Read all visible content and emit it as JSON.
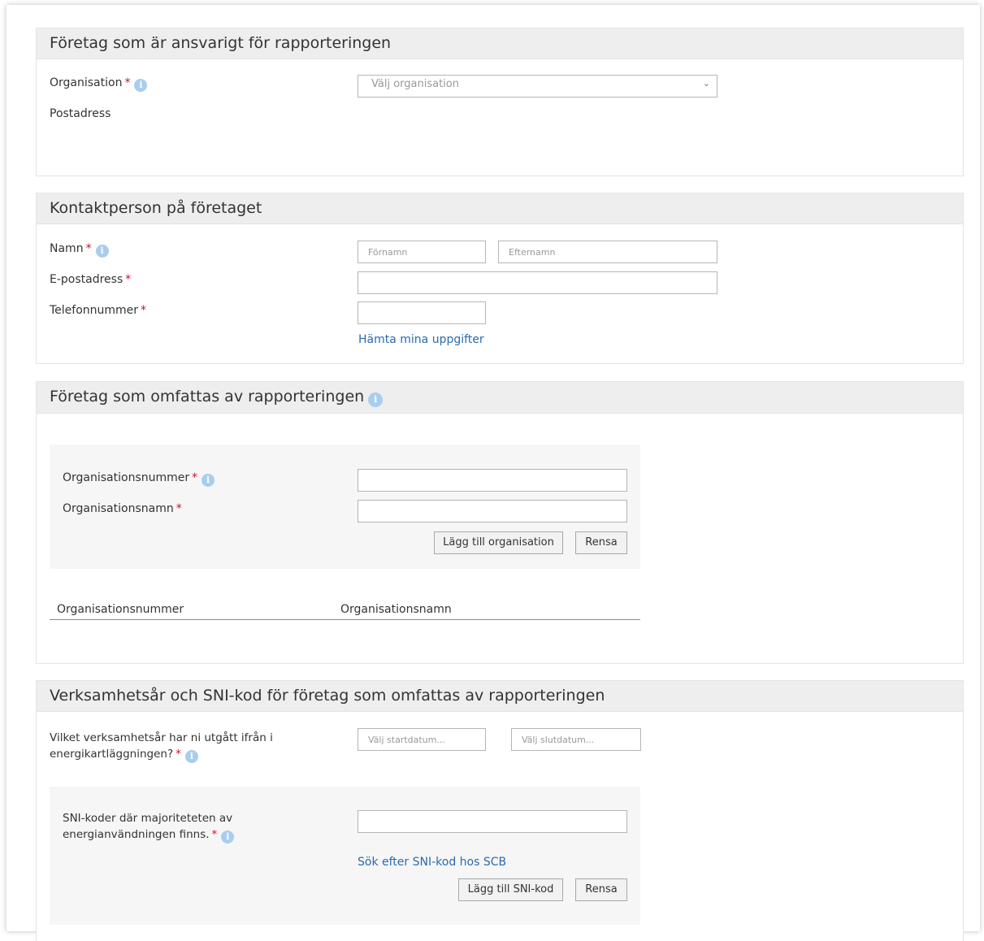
{
  "sections": {
    "responsible": {
      "title": "Företag som är ansvarigt för rapporteringen",
      "organisation_label": "Organisation",
      "organisation_placeholder": "Välj organisation",
      "postaddress_label": "Postadress"
    },
    "contact": {
      "title": "Kontaktperson på företaget",
      "name_label": "Namn",
      "firstname_placeholder": "Förnamn",
      "lastname_placeholder": "Efternamn",
      "email_label": "E-postadress",
      "phone_label": "Telefonnummer",
      "fetch_link": "Hämta mina uppgifter"
    },
    "included": {
      "title": "Företag som omfattas av rapporteringen",
      "orgnumber_label": "Organisationsnummer",
      "orgname_label": "Organisationsnamn",
      "add_button": "Lägg till organisation",
      "clear_button": "Rensa",
      "table_headers": [
        "Organisationsnummer",
        "Organisationsnamn"
      ]
    },
    "business_year": {
      "title": "Verksamhetsår och SNI-kod för företag som omfattas av rapporteringen",
      "year_label_line1": "Vilket verksamhetsår har ni utgått ifrån i",
      "year_label_line2": "energikartläggningen?",
      "start_placeholder": "Välj startdatum...",
      "end_placeholder": "Välj slutdatum...",
      "sni_label_line1": "SNI-koder där majoriteteten av",
      "sni_label_line2": "energianvändningen finns.",
      "sni_link": "Sök efter SNI-kod hos SCB",
      "add_sni_button": "Lägg till SNI-kod",
      "clear_button": "Rensa"
    }
  },
  "required_marker": "*",
  "info_glyph": "i",
  "colors": {
    "header_bg": "#eeeeee",
    "required": "#c8102e",
    "info_icon": "#a9cdee",
    "link": "#2a6ab0"
  }
}
